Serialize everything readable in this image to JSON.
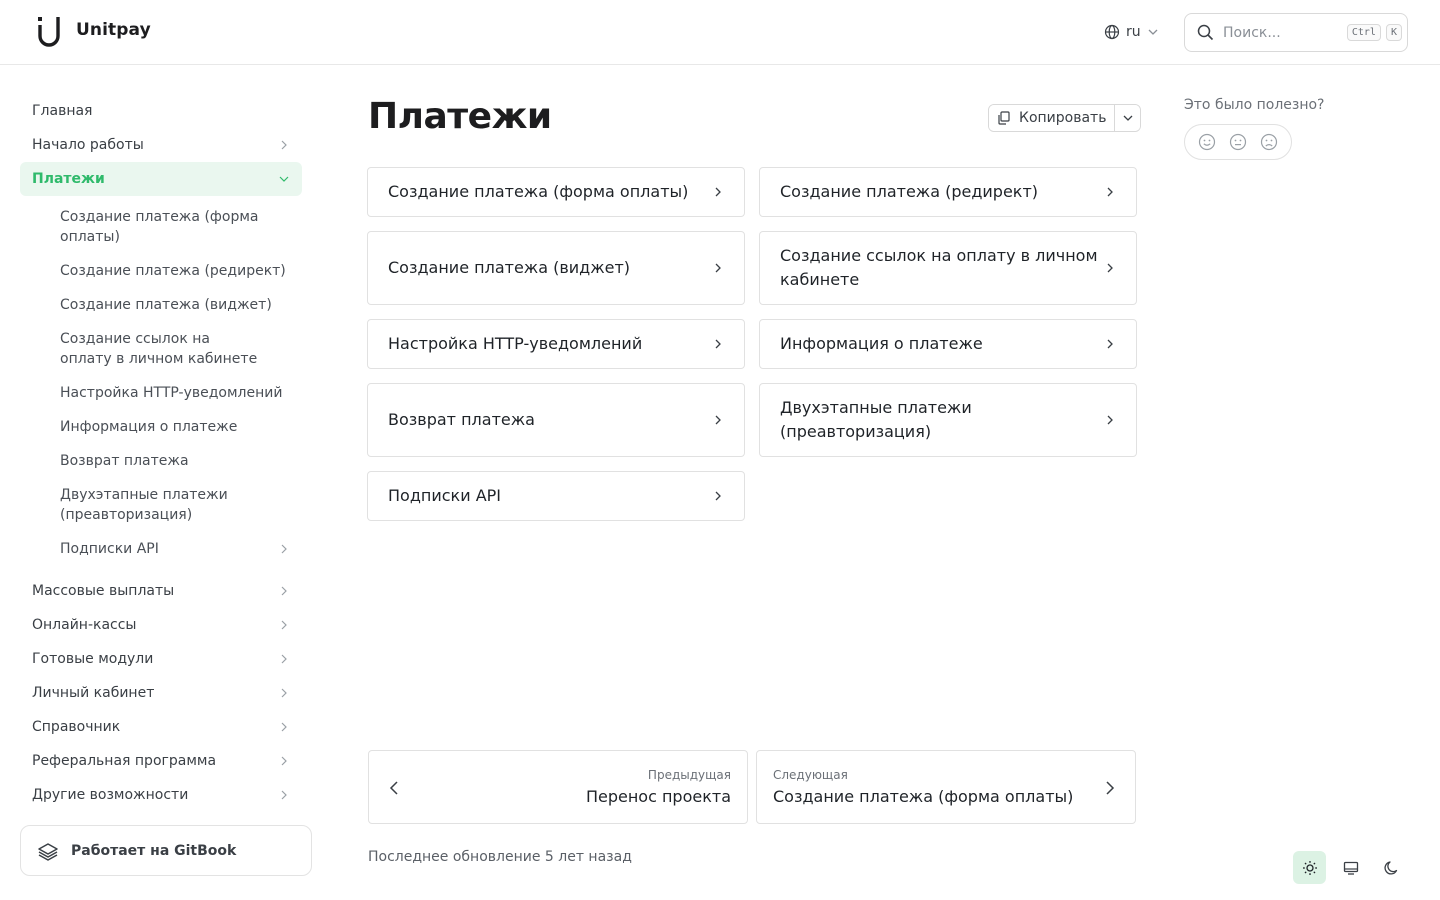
{
  "header": {
    "brand": "Unitpay",
    "language": "ru",
    "search": {
      "placeholder": "Поиск...",
      "kbd_ctrl": "Ctrl",
      "kbd_key": "K"
    }
  },
  "sidebar": {
    "items": [
      {
        "label": "Главная"
      },
      {
        "label": "Начало работы"
      },
      {
        "label": "Платежи",
        "active": true
      },
      {
        "label": "Массовые выплаты"
      },
      {
        "label": "Онлайн-кассы"
      },
      {
        "label": "Готовые модули"
      },
      {
        "label": "Личный кабинет"
      },
      {
        "label": "Справочник"
      },
      {
        "label": "Реферальная программа"
      },
      {
        "label": "Другие возможности"
      }
    ],
    "subitems": [
      {
        "label": "Создание платежа (форма оплаты)"
      },
      {
        "label": "Создание платежа (редирект)"
      },
      {
        "label": "Создание платежа (виджет)"
      },
      {
        "label": "Создание ссылок на оплату в личном кабинете"
      },
      {
        "label": "Настройка HTTP-уведомлений"
      },
      {
        "label": "Информация о платеже"
      },
      {
        "label": "Возврат платежа"
      },
      {
        "label": "Двухэтапные платежи (преавторизация)"
      },
      {
        "label": "Подписки API"
      }
    ],
    "gitbook": "Работает на GitBook"
  },
  "main": {
    "title": "Платежи",
    "copy_label": "Копировать",
    "cards": [
      {
        "label": "Создание платежа (форма оплаты)"
      },
      {
        "label": "Создание платежа (редирект)"
      },
      {
        "label": "Создание платежа (виджет)"
      },
      {
        "label": "Создание ссылок на оплату в личном кабинете"
      },
      {
        "label": "Настройка HTTP-уведомлений"
      },
      {
        "label": "Информация о платеже"
      },
      {
        "label": "Возврат платежа"
      },
      {
        "label": "Двухэтапные платежи (преавторизация)"
      },
      {
        "label": "Подписки API"
      }
    ],
    "prev": {
      "label": "Предыдущая",
      "title": "Перенос проекта"
    },
    "next": {
      "label": "Следующая",
      "title": "Создание платежа (форма оплаты)"
    },
    "updated": "Последнее обновление 5 лет назад"
  },
  "feedback": {
    "question": "Это было полезно?"
  },
  "colors": {
    "accent": "#2fba6b",
    "active_bg": "#eaf7ef",
    "theme_active_bg": "#dcf2e4"
  },
  "icons": [
    "unitpay-logo-icon",
    "globe-icon",
    "chevron-down-icon",
    "search-icon",
    "chevron-right-icon",
    "gitbook-icon",
    "copy-icon",
    "smile-icon",
    "neutral-face-icon",
    "frown-icon",
    "chevron-left-icon",
    "sun-icon",
    "monitor-icon",
    "moon-icon"
  ]
}
